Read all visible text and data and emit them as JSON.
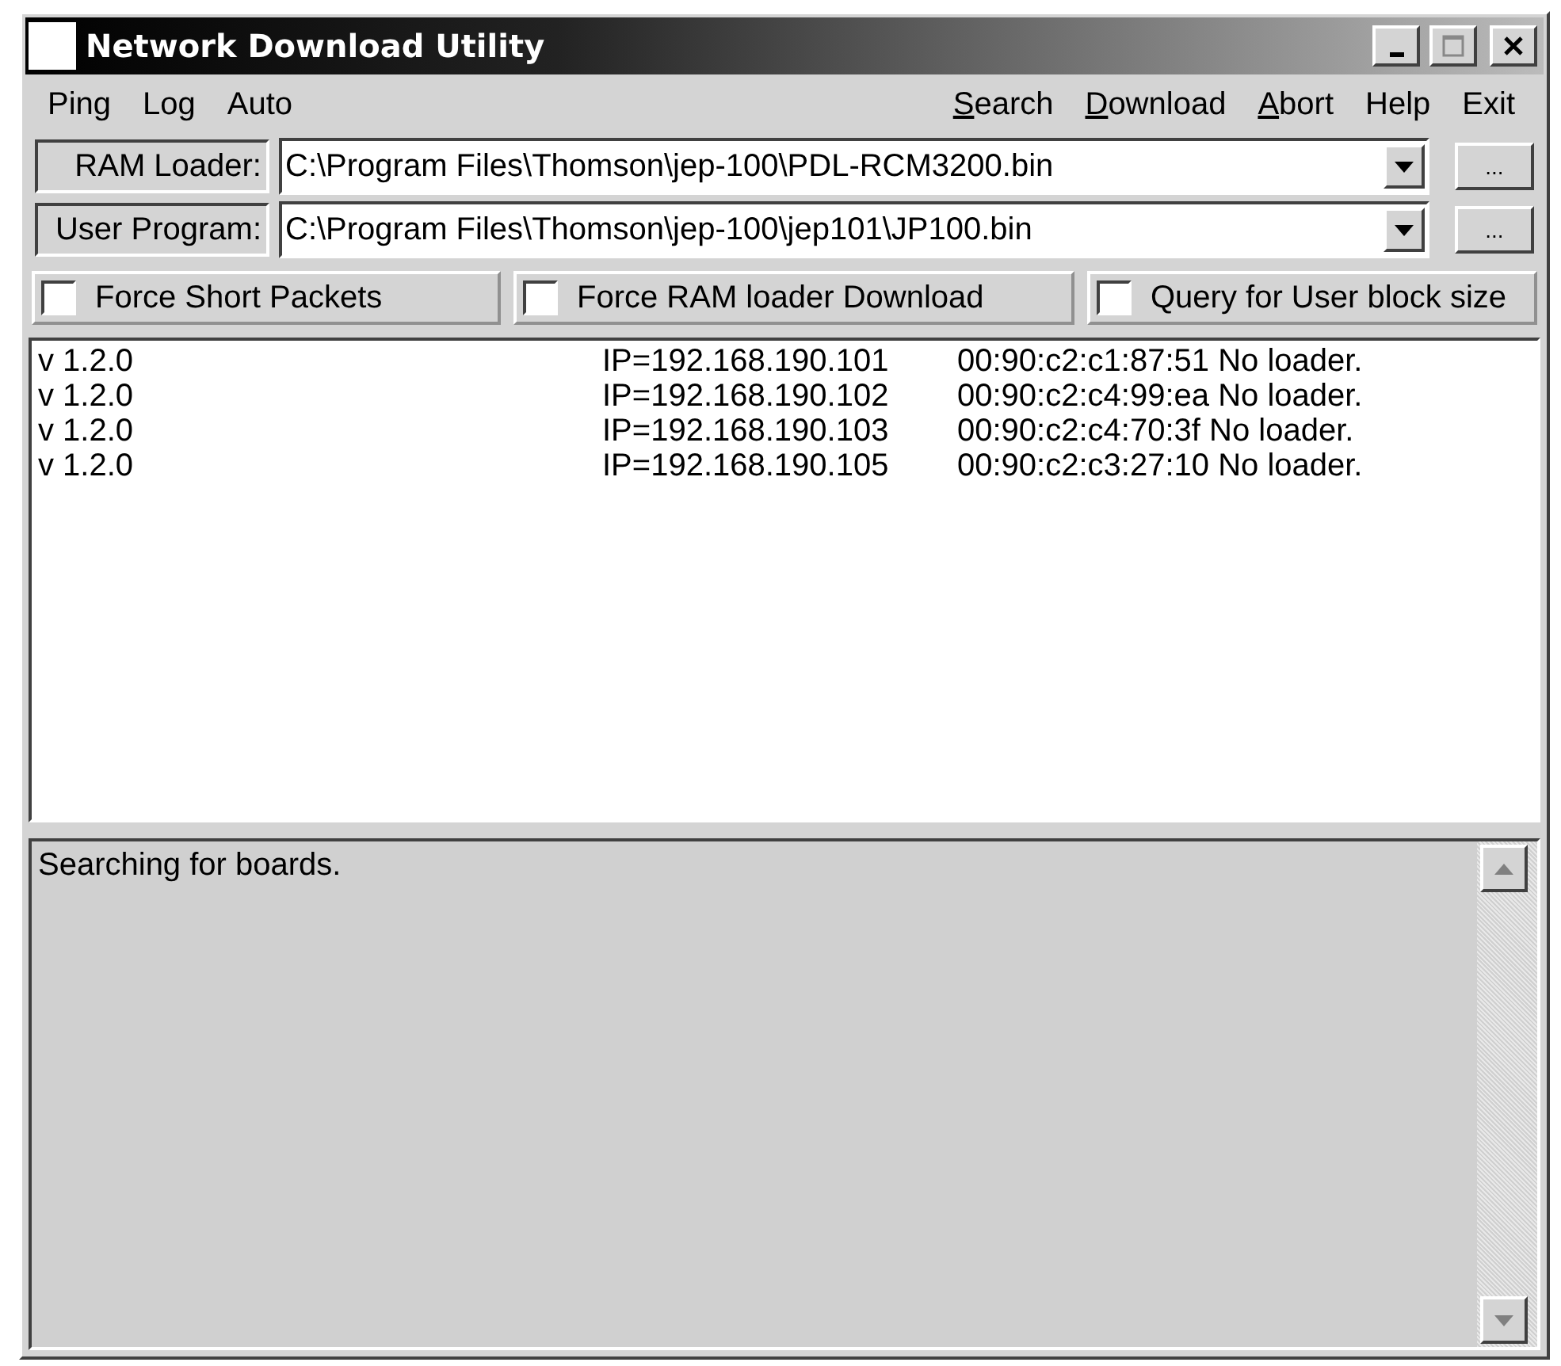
{
  "window": {
    "title": "Network Download Utility"
  },
  "menu_left": [
    {
      "label": "Ping",
      "mnemonic_first": false
    },
    {
      "label": "Log",
      "mnemonic_first": false
    },
    {
      "label": "Auto",
      "mnemonic_first": false
    }
  ],
  "menu_right": [
    {
      "label": "Search",
      "mnemonic_first": true
    },
    {
      "label": "Download",
      "mnemonic_first": true
    },
    {
      "label": "Abort",
      "mnemonic_first": true
    },
    {
      "label": "Help",
      "mnemonic_first": false
    },
    {
      "label": "Exit",
      "mnemonic_first": false
    }
  ],
  "files": [
    {
      "label": "RAM Loader:",
      "value": "C:\\Program Files\\Thomson\\jep-100\\PDL-RCM3200.bin",
      "browse": "..."
    },
    {
      "label": "User Program:",
      "value": "C:\\Program Files\\Thomson\\jep-100\\jep101\\JP100.bin",
      "browse": "..."
    }
  ],
  "options": [
    {
      "label": "Force Short Packets",
      "checked": false
    },
    {
      "label": "Force RAM loader Download",
      "checked": false
    },
    {
      "label": "Query for User block size",
      "checked": false
    }
  ],
  "boards": [
    {
      "version": "v 1.2.0",
      "ip": "IP=192.168.190.101",
      "info": "00:90:c2:c1:87:51 No loader."
    },
    {
      "version": "v 1.2.0",
      "ip": "IP=192.168.190.102",
      "info": "00:90:c2:c4:99:ea No loader."
    },
    {
      "version": "v 1.2.0",
      "ip": "IP=192.168.190.103",
      "info": "00:90:c2:c4:70:3f No loader."
    },
    {
      "version": "v 1.2.0",
      "ip": "IP=192.168.190.105",
      "info": "00:90:c2:c3:27:10 No loader."
    }
  ],
  "log": {
    "text": "Searching for boards."
  }
}
